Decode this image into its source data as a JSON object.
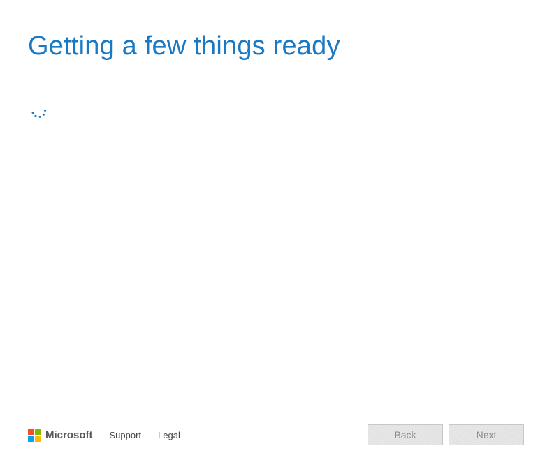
{
  "colors": {
    "accent": "#1979c3"
  },
  "header": {
    "title": "Getting a few things ready"
  },
  "footer": {
    "brand": "Microsoft",
    "links": {
      "support": "Support",
      "legal": "Legal"
    },
    "buttons": {
      "back": "Back",
      "next": "Next"
    }
  }
}
